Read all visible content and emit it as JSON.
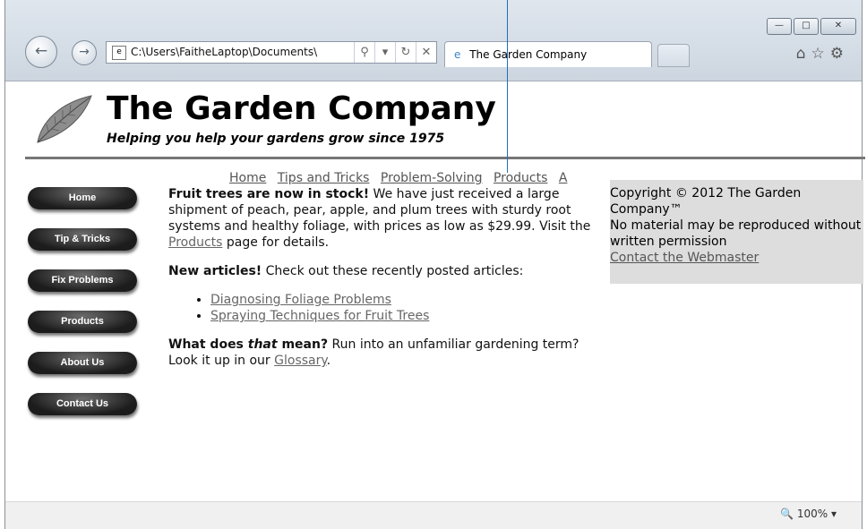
{
  "browser": {
    "address_url": "C:\\Users\\FaitheLaptop\\Documents\\",
    "tab_title": "The Garden Company",
    "zoom": "100%",
    "icons": [
      "back-icon",
      "forward-icon",
      "search-icon",
      "refresh-icon",
      "stop-icon",
      "home-icon",
      "favorites-icon",
      "tools-icon"
    ]
  },
  "header": {
    "title": "The Garden Company",
    "tagline": "Helping you help your gardens grow since 1975"
  },
  "sidebar": {
    "buttons": [
      "Home",
      "Tip & Tricks",
      "Fix Problems",
      "Products",
      "About Us",
      "Contact Us"
    ]
  },
  "topnav": {
    "links": [
      "Home",
      "Tips and Tricks",
      "Problem-Solving",
      "Products",
      "A"
    ]
  },
  "main": {
    "p1_bold": "Fruit trees are now in stock!",
    "p1_text": " We have just received a large shipment of peach, pear, apple, and plum trees with sturdy root systems and healthy foliage, with prices as low as $29.99. Visit the ",
    "p1_link": "Products",
    "p1_end": " page for details.",
    "p2_bold": "New articles!",
    "p2_text": " Check out these recently posted articles:",
    "articles": [
      "Diagnosing Foliage Problems",
      "Spraying Techniques for Fruit Trees"
    ],
    "p3_bold_a": "What does ",
    "p3_italic": "that",
    "p3_bold_b": " mean?",
    "p3_text": " Run into an unfamiliar gardening term? Look it up in our ",
    "p3_link": "Glossary",
    "p3_end": "."
  },
  "aside": {
    "copyright": "Copyright © 2012 The Garden Company™",
    "notice": "No material may be reproduced without written permission",
    "contact_link": "Contact the Webmaster"
  }
}
